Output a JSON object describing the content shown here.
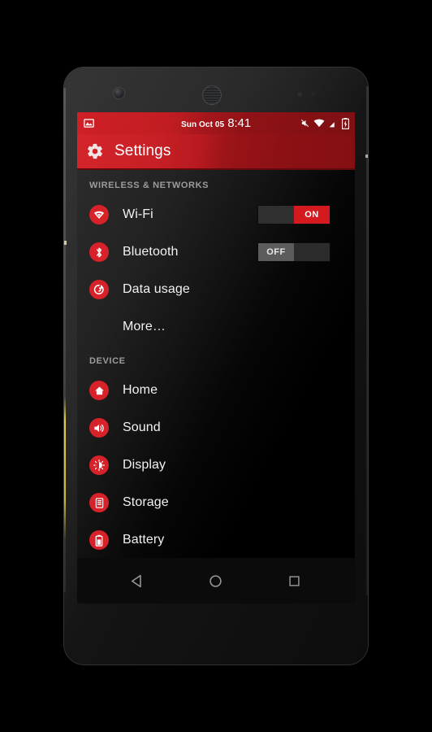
{
  "device": {
    "frame_name": "android-phone",
    "hardware": {
      "front_camera": "front-camera",
      "earpiece": "earpiece-speaker",
      "proximity_sensor": "proximity-sensor"
    }
  },
  "status_bar": {
    "notification_icons": [
      "photo-icon"
    ],
    "date": "Sun Oct 05",
    "time": "8:41",
    "system_icons": [
      "vibrate-mute-icon",
      "wifi-icon",
      "cellular-signal-icon",
      "battery-charging-icon"
    ],
    "background_color": "#c01d22"
  },
  "action_bar": {
    "icon": "gear-icon",
    "title": "Settings",
    "background_color": "#b81a20"
  },
  "sections": [
    {
      "header": "WIRELESS & NETWORKS",
      "items": [
        {
          "icon": "wifi-icon",
          "label": "Wi-Fi",
          "toggle": {
            "state": "on",
            "label": "ON"
          }
        },
        {
          "icon": "bluetooth-icon",
          "label": "Bluetooth",
          "toggle": {
            "state": "off",
            "label": "OFF"
          }
        },
        {
          "icon": "data-usage-icon",
          "label": "Data usage",
          "toggle": null
        },
        {
          "icon": "none",
          "label": "More…",
          "toggle": null
        }
      ]
    },
    {
      "header": "DEVICE",
      "items": [
        {
          "icon": "home-icon",
          "label": "Home",
          "toggle": null
        },
        {
          "icon": "sound-icon",
          "label": "Sound",
          "toggle": null
        },
        {
          "icon": "display-icon",
          "label": "Display",
          "toggle": null
        },
        {
          "icon": "storage-icon",
          "label": "Storage",
          "toggle": null
        },
        {
          "icon": "battery-icon",
          "label": "Battery",
          "toggle": null
        }
      ]
    }
  ],
  "nav_bar": {
    "buttons": [
      {
        "name": "back-button",
        "icon": "triangle-left-icon"
      },
      {
        "name": "home-button",
        "icon": "circle-icon"
      },
      {
        "name": "recents-button",
        "icon": "square-icon"
      }
    ]
  },
  "theme": {
    "accent_red": "#d8222a",
    "icon_circle_red": "#d8222a",
    "toggle_on_red": "#d4191f",
    "toggle_off_gray": "#5c5c5c",
    "section_header_gray": "#9c9c9c",
    "label_white": "#f2f2f2",
    "screen_black": "#000000"
  }
}
